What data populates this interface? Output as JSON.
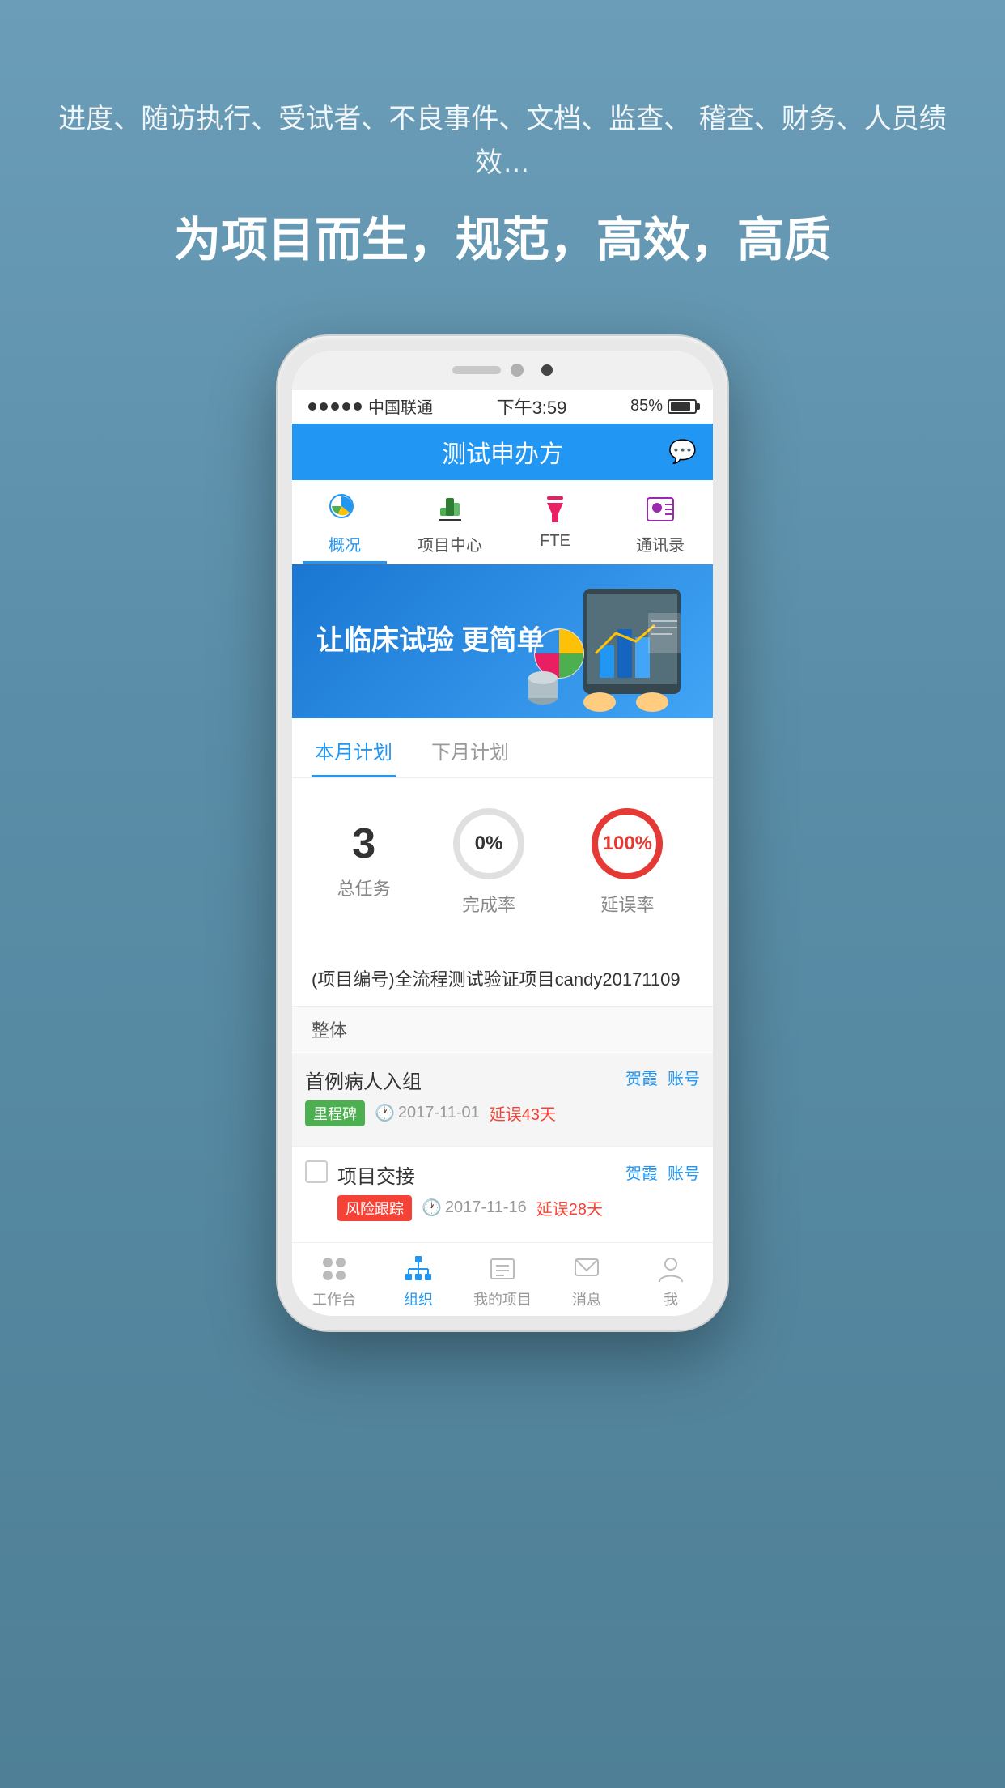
{
  "page": {
    "background_color": "#5b8fa8"
  },
  "hero": {
    "subtitle": "进度、随访执行、受试者、不良事件、文档、监查、\n稽查、财务、人员绩效…",
    "title": "为项目而生，规范，高效，高质"
  },
  "status_bar": {
    "signal_label": "中国联通",
    "time": "下午3:59",
    "battery": "85%"
  },
  "app_header": {
    "title": "测试申办方",
    "chat_icon": "💬"
  },
  "nav_tabs": [
    {
      "id": "overview",
      "label": "概况",
      "active": true
    },
    {
      "id": "project",
      "label": "项目中心",
      "active": false
    },
    {
      "id": "fte",
      "label": "FTE",
      "active": false
    },
    {
      "id": "contacts",
      "label": "通讯录",
      "active": false
    }
  ],
  "banner": {
    "text": "让临床试验\n更简单"
  },
  "plan_tabs": [
    {
      "id": "this_month",
      "label": "本月计划",
      "active": true
    },
    {
      "id": "next_month",
      "label": "下月计划",
      "active": false
    }
  ],
  "stats": {
    "total_tasks": {
      "value": "3",
      "label": "总任务"
    },
    "completion_rate": {
      "value": "0%",
      "label": "完成率",
      "percent": 0
    },
    "delay_rate": {
      "value": "100%",
      "label": "延误率",
      "percent": 100
    }
  },
  "project_section": {
    "title": "(项目编号)全流程测试验证项目candy20171109",
    "subtitle": "整体"
  },
  "tasks": [
    {
      "id": 1,
      "title": "首例病人入组",
      "tag": "里程碑",
      "tag_type": "green",
      "date": "2017-11-01",
      "delay": "延误43天",
      "assignees": [
        "贺霞",
        "账号"
      ],
      "has_checkbox": false
    },
    {
      "id": 2,
      "title": "项目交接",
      "tag": "风险跟踪",
      "tag_type": "red",
      "date": "2017-11-16",
      "delay": "延误28天",
      "assignees": [
        "贺霞",
        "账号"
      ],
      "has_checkbox": true
    }
  ],
  "bottom_nav": [
    {
      "id": "workbench",
      "label": "工作台",
      "active": false,
      "icon": "🎨"
    },
    {
      "id": "org",
      "label": "组织",
      "active": true,
      "icon": "🏢"
    },
    {
      "id": "my_project",
      "label": "我的项目",
      "active": false,
      "icon": "📋"
    },
    {
      "id": "messages",
      "label": "消息",
      "active": false,
      "icon": "✉️"
    },
    {
      "id": "me",
      "label": "我",
      "active": false,
      "icon": "👤"
    }
  ]
}
